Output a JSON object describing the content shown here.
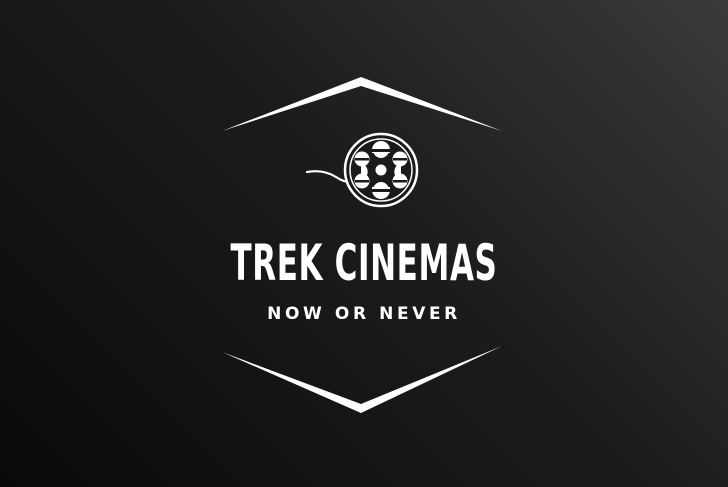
{
  "logo": {
    "brand_name": "TREK CINEMAS",
    "tagline": "NOW OR NEVER",
    "icon": "film-reel-icon",
    "colors": {
      "foreground": "#ffffff",
      "background_dark": "#0a0a0a",
      "background_light": "#3a3a3a"
    }
  }
}
